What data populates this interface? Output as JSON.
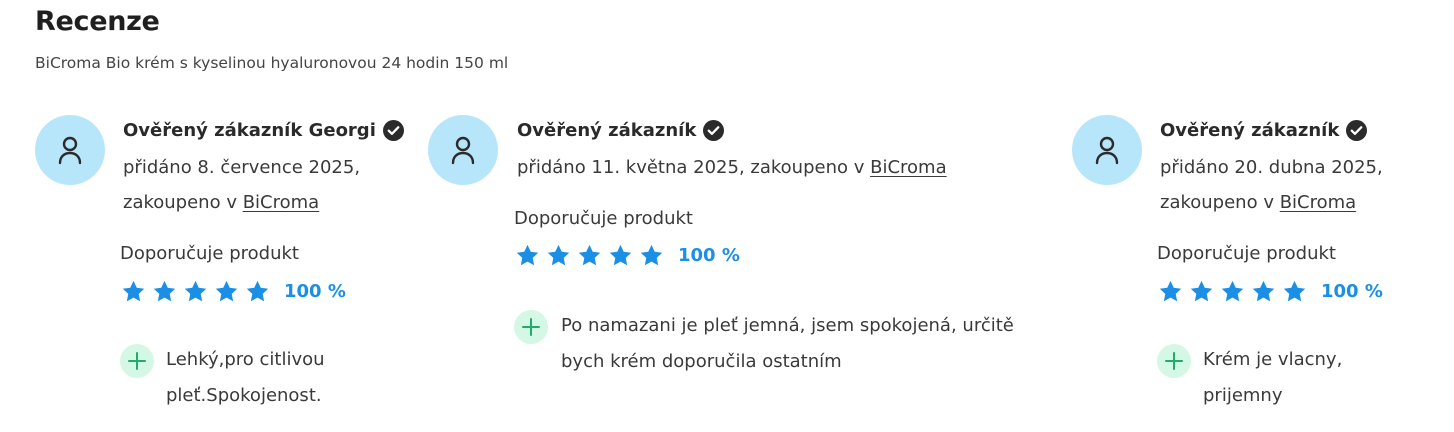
{
  "header": {
    "title": "Recenze",
    "subtitle": "BiCroma Bio krém s kyselinou hyaluronovou 24 hodin 150 ml"
  },
  "icons": {
    "avatar": "user-icon",
    "verified": "verified-check-icon",
    "star": "star-icon",
    "plus": "plus-icon"
  },
  "colors": {
    "avatar_bg": "#b7e6fb",
    "star": "#1b8fe6",
    "percent": "#1b8fe6",
    "plus_bg": "#d5f8e6",
    "plus": "#1fae6a"
  },
  "reviews": [
    {
      "author": "Ověřený zákazník Georgi",
      "meta_line1": "přidáno 8. července 2025,",
      "meta_line2": "zakoupeno v ",
      "shop": "BiCroma",
      "recommend": "Doporučuje produkt",
      "stars": 5,
      "percent": "100 %",
      "pro_line1": "Lehký,pro citlivou",
      "pro_line2": "pleť.Spokojenost."
    },
    {
      "author": "Ověřený zákazník",
      "meta_line1": "přidáno 11. května 2025, zakoupeno v ",
      "shop": "BiCroma",
      "recommend": "Doporučuje produkt",
      "stars": 5,
      "percent": "100 %",
      "pro_line1": "Po namazani je pleť jemná, jsem spokojená, určitě",
      "pro_line2": "bych krém doporučila ostatním"
    },
    {
      "author": "Ověřený zákazník",
      "meta_line1": "přidáno 20. dubna 2025,",
      "meta_line2": "zakoupeno v ",
      "shop": "BiCroma",
      "recommend": "Doporučuje produkt",
      "stars": 5,
      "percent": "100 %",
      "pro_line1": "Krém je vlacny,",
      "pro_line2": "prijemny"
    }
  ]
}
